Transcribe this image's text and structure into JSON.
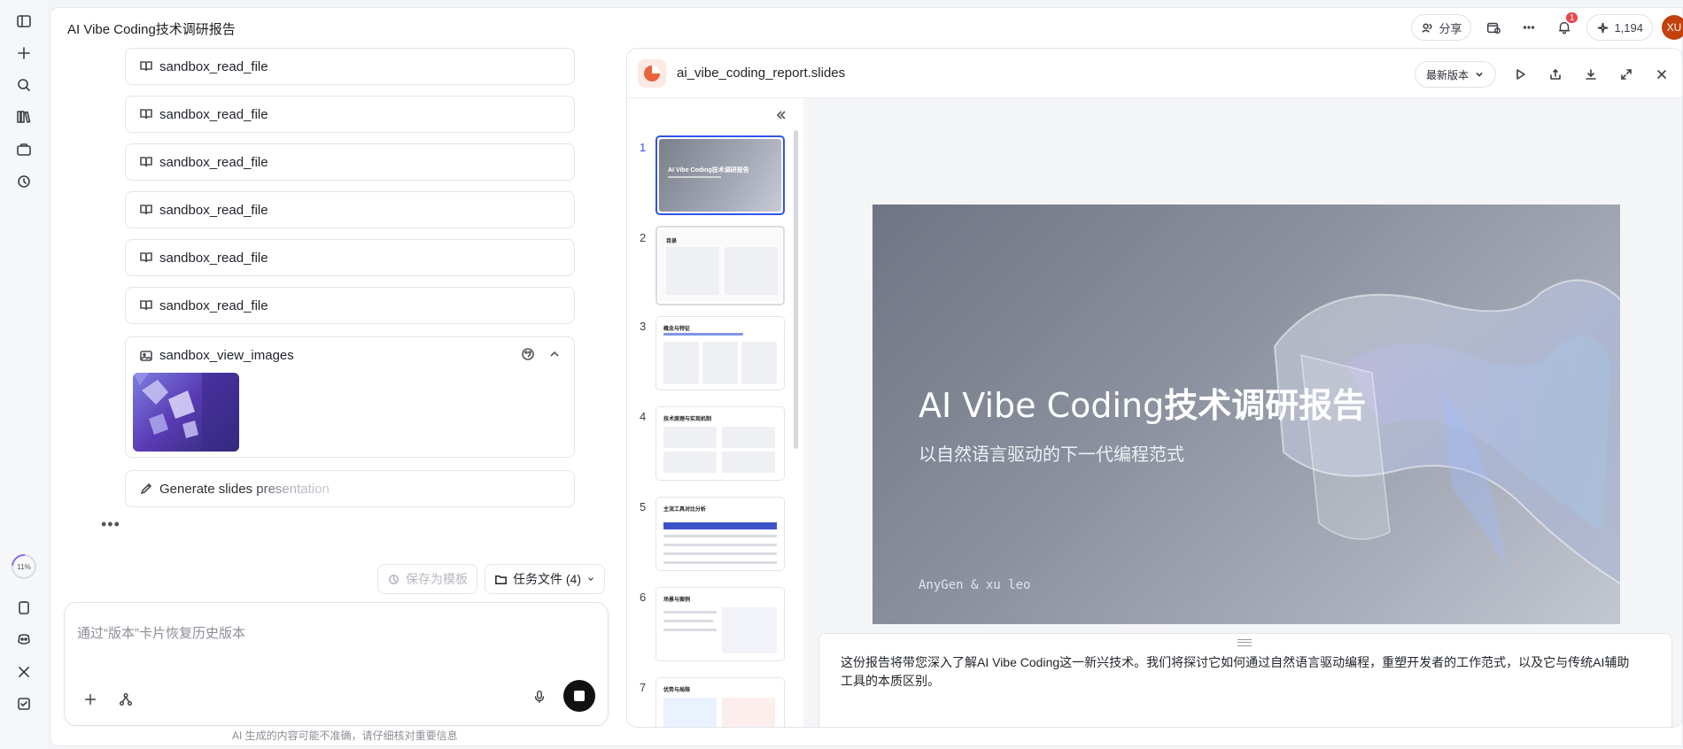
{
  "app": {
    "doc_title": "AI Vibe Coding技术调研报告",
    "share_label": "分享",
    "notification_count": "1",
    "credits": "1,194",
    "avatar_initials": "XU",
    "progress_label": "11%"
  },
  "rail": {
    "icons": [
      "sidebar-toggle-icon",
      "plus-icon",
      "search-icon",
      "library-icon",
      "briefcase-icon",
      "history-icon",
      "clipboard-icon",
      "discord-icon",
      "x-icon",
      "feedback-icon"
    ]
  },
  "chat": {
    "tool_calls": [
      {
        "label": "sandbox_read_file",
        "icon": "book-icon"
      },
      {
        "label": "sandbox_read_file",
        "icon": "book-icon"
      },
      {
        "label": "sandbox_read_file",
        "icon": "book-icon"
      },
      {
        "label": "sandbox_read_file",
        "icon": "book-icon"
      },
      {
        "label": "sandbox_read_file",
        "icon": "book-icon"
      },
      {
        "label": "sandbox_read_file",
        "icon": "book-icon"
      }
    ],
    "view_images_label": "sandbox_view_images",
    "generate_label": "Generate slides presentation",
    "save_template_label": "保存为模板",
    "task_files_label": "任务文件 (4)",
    "input_placeholder": "通过“版本”卡片恢复历史版本",
    "disclaimer": "AI 生成的内容可能不准确，请仔细核对重要信息"
  },
  "slides_panel": {
    "file_name": "ai_vibe_coding_report.slides",
    "version_label": "最新版本",
    "thumbnails": [
      {
        "num": "1",
        "mini_title": "AI Vibe Coding技术调研报告"
      },
      {
        "num": "2",
        "mini_title": "目录"
      },
      {
        "num": "3",
        "mini_title": "概念与特征"
      },
      {
        "num": "4",
        "mini_title": "技术原理与实现机制"
      },
      {
        "num": "5",
        "mini_title": "主流工具对比分析"
      },
      {
        "num": "6",
        "mini_title": "场景与案例"
      },
      {
        "num": "7",
        "mini_title": "优势与局限"
      }
    ],
    "current_slide": {
      "title_latin": "AI Vibe Coding",
      "title_cjk": "技术调研报告",
      "subtitle": "以自然语言驱动的下一代编程范式",
      "author": "AnyGen & xu leo"
    },
    "notes": "这份报告将带您深入了解AI Vibe Coding这一新兴技术。我们将探讨它如何通过自然语言驱动编程，重塑开发者的工作范式，以及它与传统AI辅助工具的本质区别。"
  },
  "colors": {
    "accent_blue": "#2f54eb",
    "badge_red": "#e5484d",
    "avatar_orange": "#c2410c",
    "file_icon_orange": "#e8643b"
  }
}
